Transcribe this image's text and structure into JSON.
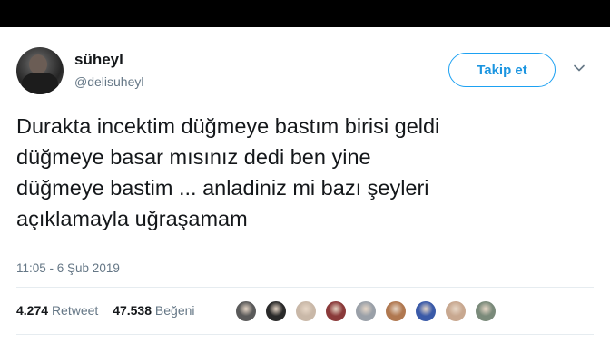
{
  "user": {
    "name": "süheyl",
    "handle": "@delisuheyl"
  },
  "follow_button": {
    "label": "Takip et"
  },
  "tweet": {
    "lines": [
      "Durakta incektim düğmeye bastım birisi geldi",
      "düğmeye basar mısınız dedi ben yine",
      "düğmeye bastim ... anladiniz mi bazı şeyleri",
      "açıklamayla uğraşamam"
    ],
    "timestamp": "11:05 - 6 Şub 2019"
  },
  "stats": {
    "retweets_count": "4.274",
    "retweets_label": "Retweet",
    "likes_count": "47.538",
    "likes_label": "Beğeni"
  },
  "likers": [
    {
      "icon": "liker-avatar",
      "color": "#5a5a5a"
    },
    {
      "icon": "liker-avatar",
      "color": "#2a2a2a"
    },
    {
      "icon": "liker-avatar",
      "color": "#c9b8a8"
    },
    {
      "icon": "liker-avatar",
      "color": "#8a3a3a"
    },
    {
      "icon": "liker-avatar",
      "color": "#9aa0a8"
    },
    {
      "icon": "liker-avatar",
      "color": "#b07850"
    },
    {
      "icon": "liker-avatar",
      "color": "#3a5aa8"
    },
    {
      "icon": "liker-avatar",
      "color": "#c8a890"
    },
    {
      "icon": "liker-avatar",
      "color": "#7a8a7a"
    }
  ],
  "colors": {
    "accent": "#1da1f2",
    "text": "#14171a",
    "muted": "#657786"
  }
}
